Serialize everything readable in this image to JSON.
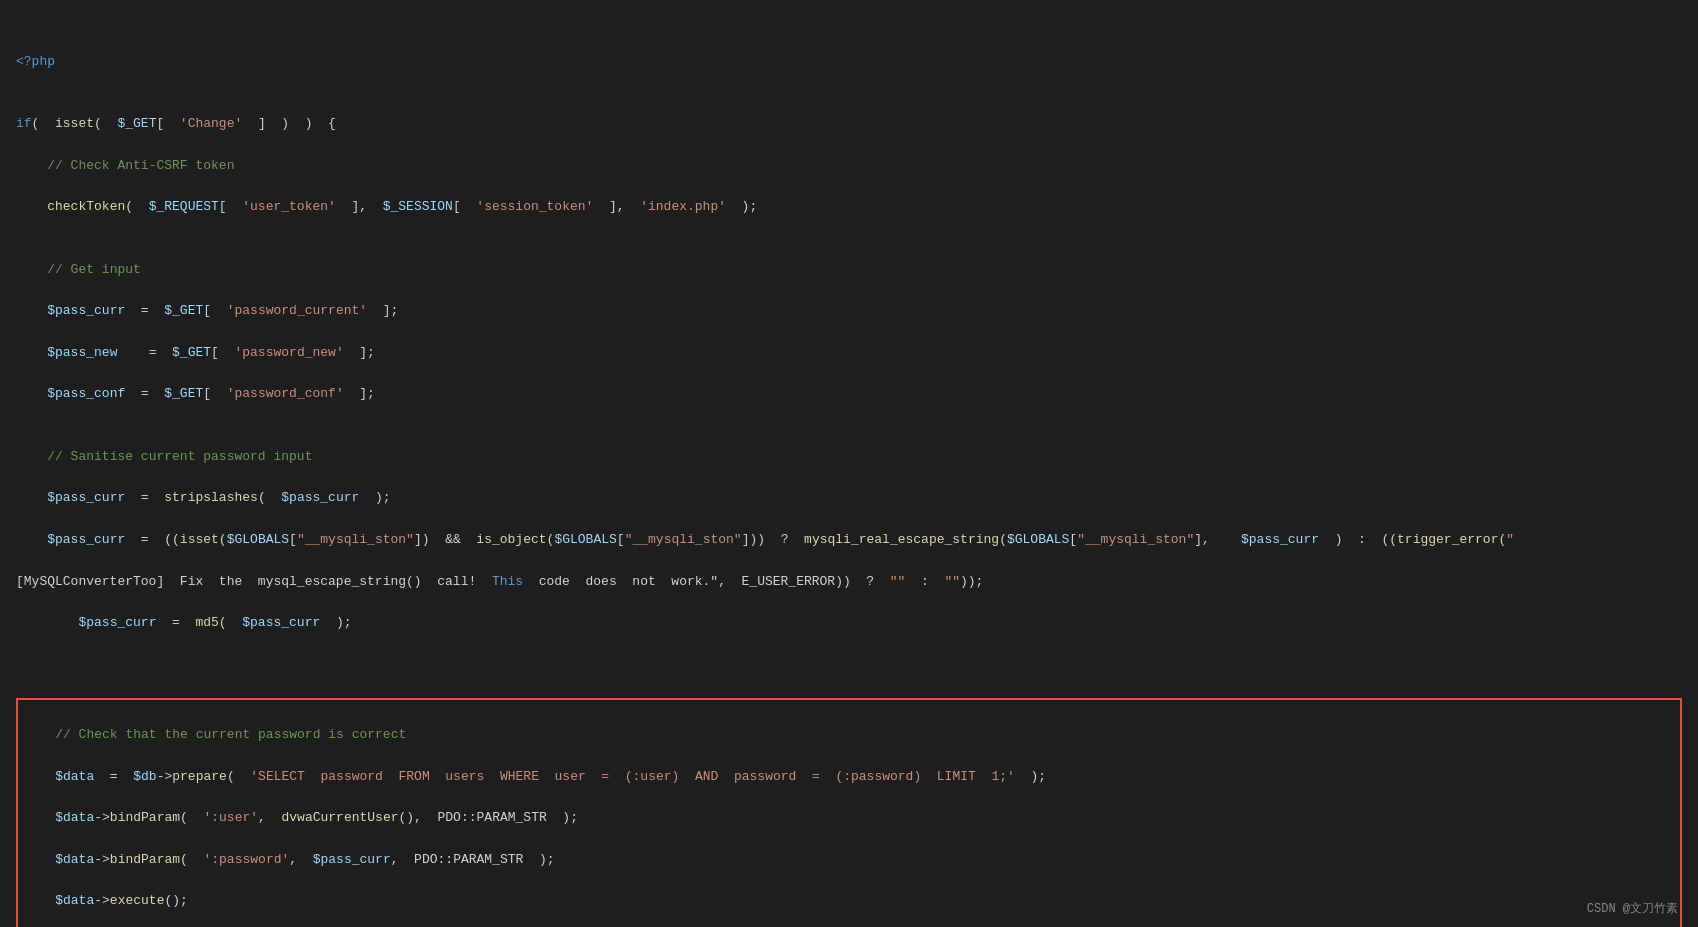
{
  "code": {
    "lines": []
  },
  "watermark": "CSDN @文刀竹素"
}
